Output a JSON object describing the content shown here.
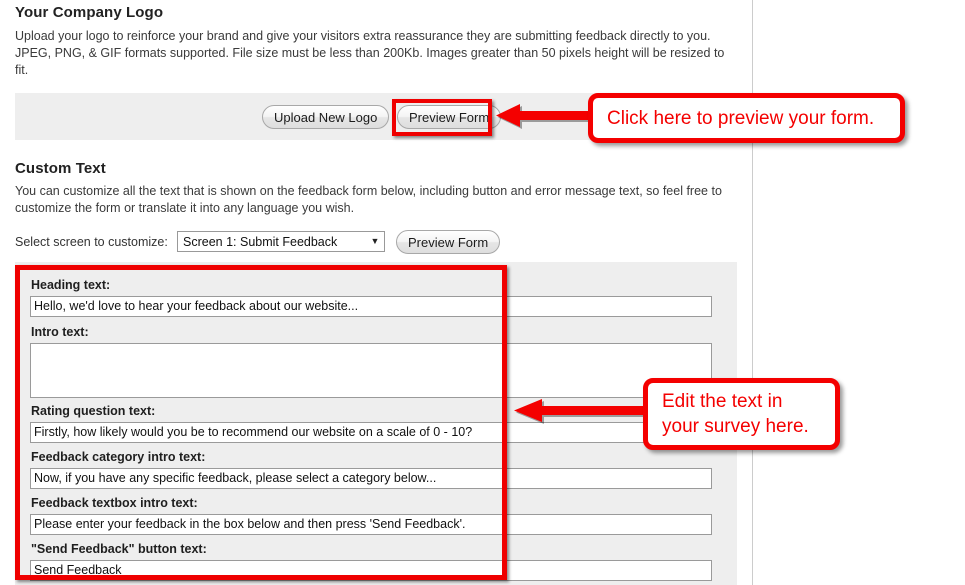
{
  "logo_section": {
    "title": "Your Company Logo",
    "description": "Upload your logo to reinforce your brand and give your visitors extra reassurance they are submitting feedback directly to you. JPEG, PNG, & GIF formats supported. File size must be less than 200Kb. Images greater than 50 pixels height will be resized to fit.",
    "upload_button": "Upload New Logo",
    "preview_button": "Preview Form"
  },
  "custom_text_section": {
    "title": "Custom Text",
    "description": "You can customize all the text that is shown on the feedback form below, including button and error message text, so feel free to customize the form or translate it into any language you wish.",
    "select_label": "Select screen to customize:",
    "selected_screen": "Screen 1: Submit Feedback",
    "select_arrow": "chevron-down-icon",
    "preview_button": "Preview Form"
  },
  "fields": [
    {
      "label": "Heading text:",
      "value": "Hello, we'd love to hear your feedback about our website...",
      "type": "text"
    },
    {
      "label": "Intro text:",
      "value": "",
      "type": "textarea"
    },
    {
      "label": "Rating question text:",
      "value": "Firstly, how likely would you be to recommend our website on a scale of 0 - 10?",
      "type": "text"
    },
    {
      "label": "Feedback category intro text:",
      "value": "Now, if you have any specific feedback, please select a category below...",
      "type": "text"
    },
    {
      "label": "Feedback textbox intro text:",
      "value": "Please enter your feedback in the box below and then press 'Send Feedback'.",
      "type": "text"
    },
    {
      "label": "\"Send Feedback\" button text:",
      "value": "Send Feedback",
      "type": "text"
    }
  ],
  "annotations": {
    "callout_1": "Click here to preview your form.",
    "callout_2": "Edit the text in\nyour survey here.",
    "accent_color": "#f40000",
    "highlight_color": "#ef0000"
  }
}
